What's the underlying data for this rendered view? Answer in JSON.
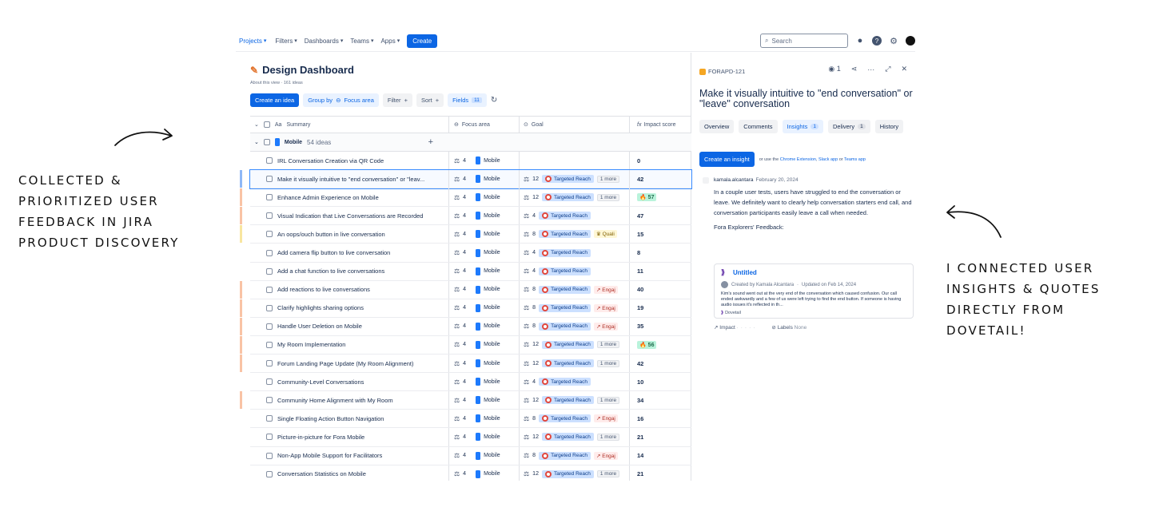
{
  "annotations": {
    "left": "Collected & prioritized user feedback in Jira Product Discovery",
    "right": "I connected user insights & quotes directly from Dovetail!"
  },
  "nav": {
    "items": [
      "Projects",
      "Filters",
      "Dashboards",
      "Teams",
      "Apps"
    ],
    "create": "Create",
    "search_placeholder": "Search"
  },
  "view": {
    "title": "Design Dashboard",
    "subtitle": "About this view · 161 ideas",
    "toolbar": {
      "create_idea": "Create an idea",
      "group_by": "Group by",
      "group_value": "Focus area",
      "filter": "Filter",
      "sort": "Sort",
      "fields": "Fields",
      "fields_count": "11"
    },
    "columns": {
      "summary": "Summary",
      "focus": "Focus area",
      "goal": "Goal",
      "impact": "Impact score"
    },
    "group": {
      "label": "Mobile",
      "count": "54 ideas"
    }
  },
  "rows": [
    {
      "summary": "IRL Conversation Creation via QR Code",
      "effort": "4",
      "focus": "Mobile",
      "goalNum": "",
      "goal": "",
      "extra": "",
      "extraType": "",
      "impact": "0",
      "hot": false,
      "stripe": ""
    },
    {
      "summary": "Make it visually intuitive to \"end conversation\" or \"leav...",
      "effort": "4",
      "focus": "Mobile",
      "goalNum": "12",
      "goal": "Targeted Reach",
      "extra": "1 more",
      "extraType": "more",
      "impact": "42",
      "hot": false,
      "stripe": "#8fb8f6",
      "selected": true
    },
    {
      "summary": "Enhance Admin Experience on Mobile",
      "effort": "4",
      "focus": "Mobile",
      "goalNum": "12",
      "goal": "Targeted Reach",
      "extra": "1 more",
      "extraType": "more",
      "impact": "57",
      "hot": true,
      "stripe": "#f9c3a5"
    },
    {
      "summary": "Visual Indication that Live Conversations are Recorded",
      "effort": "4",
      "focus": "Mobile",
      "goalNum": "4",
      "goal": "Targeted Reach",
      "extra": "",
      "extraType": "",
      "impact": "47",
      "hot": false,
      "stripe": "#f9c3a5"
    },
    {
      "summary": "An oops/ouch button in live conversation",
      "effort": "4",
      "focus": "Mobile",
      "goalNum": "8",
      "goal": "Targeted Reach",
      "extra": "Quali",
      "extraType": "qual",
      "impact": "15",
      "hot": false,
      "stripe": "#f8e6a0"
    },
    {
      "summary": "Add camera flip button to live conversation",
      "effort": "4",
      "focus": "Mobile",
      "goalNum": "4",
      "goal": "Targeted Reach",
      "extra": "",
      "extraType": "",
      "impact": "8",
      "hot": false,
      "stripe": ""
    },
    {
      "summary": "Add a chat function to live conversations",
      "effort": "4",
      "focus": "Mobile",
      "goalNum": "4",
      "goal": "Targeted Reach",
      "extra": "",
      "extraType": "",
      "impact": "11",
      "hot": false,
      "stripe": ""
    },
    {
      "summary": "Add reactions to live conversations",
      "effort": "4",
      "focus": "Mobile",
      "goalNum": "8",
      "goal": "Targeted Reach",
      "extra": "Engaj",
      "extraType": "eng",
      "impact": "40",
      "hot": false,
      "stripe": "#f9c3a5"
    },
    {
      "summary": "Clarify highlights sharing options",
      "effort": "4",
      "focus": "Mobile",
      "goalNum": "8",
      "goal": "Targeted Reach",
      "extra": "Engaj",
      "extraType": "eng",
      "impact": "19",
      "hot": false,
      "stripe": "#f9c3a5"
    },
    {
      "summary": "Handle User Deletion on Mobile",
      "effort": "4",
      "focus": "Mobile",
      "goalNum": "8",
      "goal": "Targeted Reach",
      "extra": "Engaj",
      "extraType": "eng",
      "impact": "35",
      "hot": false,
      "stripe": "#f9c3a5"
    },
    {
      "summary": "My Room Implementation",
      "effort": "4",
      "focus": "Mobile",
      "goalNum": "12",
      "goal": "Targeted Reach",
      "extra": "1 more",
      "extraType": "more",
      "impact": "56",
      "hot": true,
      "stripe": "#f9c3a5"
    },
    {
      "summary": "Forum Landing Page Update (My Room Alignment)",
      "effort": "4",
      "focus": "Mobile",
      "goalNum": "12",
      "goal": "Targeted Reach",
      "extra": "1 more",
      "extraType": "more",
      "impact": "42",
      "hot": false,
      "stripe": "#f9c3a5"
    },
    {
      "summary": "Community-Level Conversations",
      "effort": "4",
      "focus": "Mobile",
      "goalNum": "4",
      "goal": "Targeted Reach",
      "extra": "",
      "extraType": "",
      "impact": "10",
      "hot": false,
      "stripe": ""
    },
    {
      "summary": "Community Home Alignment with My Room",
      "effort": "4",
      "focus": "Mobile",
      "goalNum": "12",
      "goal": "Targeted Reach",
      "extra": "1 more",
      "extraType": "more",
      "impact": "34",
      "hot": false,
      "stripe": "#f9c3a5"
    },
    {
      "summary": "Single Floating Action Button Navigation",
      "effort": "4",
      "focus": "Mobile",
      "goalNum": "8",
      "goal": "Targeted Reach",
      "extra": "Engaj",
      "extraType": "eng",
      "impact": "16",
      "hot": false,
      "stripe": ""
    },
    {
      "summary": "Picture-in-picture for Fora Mobile",
      "effort": "4",
      "focus": "Mobile",
      "goalNum": "12",
      "goal": "Targeted Reach",
      "extra": "1 more",
      "extraType": "more",
      "impact": "21",
      "hot": false,
      "stripe": ""
    },
    {
      "summary": "Non-App Mobile Support for Facilitators",
      "effort": "4",
      "focus": "Mobile",
      "goalNum": "8",
      "goal": "Targeted Reach",
      "extra": "Engaj",
      "extraType": "eng",
      "impact": "14",
      "hot": false,
      "stripe": ""
    },
    {
      "summary": "Conversation Statistics on Mobile",
      "effort": "4",
      "focus": "Mobile",
      "goalNum": "12",
      "goal": "Targeted Reach",
      "extra": "1 more",
      "extraType": "more",
      "impact": "21",
      "hot": false,
      "stripe": ""
    }
  ],
  "details": {
    "key": "FORAPD-121",
    "watchers": "1",
    "title": "Make it visually intuitive to \"end conversation\" or \"leave\" conversation",
    "tabs": [
      {
        "label": "Overview",
        "count": ""
      },
      {
        "label": "Comments",
        "count": ""
      },
      {
        "label": "Insights",
        "count": "1"
      },
      {
        "label": "Delivery",
        "count": "1"
      },
      {
        "label": "History",
        "count": ""
      }
    ],
    "create_insight": "Create an insight",
    "insight_hint_pre": "or use the",
    "insight_link1": "Chrome Extension",
    "insight_link2": "Slack app",
    "insight_mid": "or",
    "insight_link3": "Teams app",
    "comment": {
      "author": "kamala.alcantara",
      "date": "February 20, 2024",
      "body": "In a couple user tests, users have struggled to end the conversation or leave. We definitely want to clearly help conversation starters end call, and conversation participants easily leave a call when needed.",
      "feedback_label": "Fora Explorers' Feedback:"
    },
    "card": {
      "title": "Untitled",
      "meta_author": "Created by Kamala Alcantara",
      "meta_updated": "Updated on Feb 14, 2024",
      "text": "Kim's sound went out at the very end of the conversation which caused confusion. Our call ended awkwardly and a few of us were left trying to find the end button. If someone is having audio issues it's reflected in th...",
      "source": "Dovetail"
    },
    "footer": {
      "impact": "Impact",
      "labels": "Labels",
      "labels_value": "None"
    }
  }
}
